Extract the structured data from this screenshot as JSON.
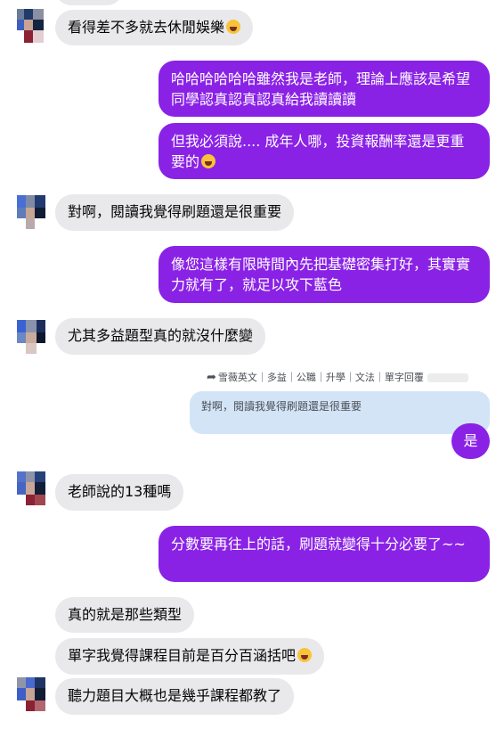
{
  "messages": {
    "m1": {
      "text": "看得差不多就去休閒娛樂"
    },
    "m2": {
      "text": "哈哈哈哈哈哈雖然我是老師，理論上應該是希望同學認真認真認真給我讀讀讀"
    },
    "m3": {
      "text": "但我必須說....  成年人哪，投資報酬率還是更重要的"
    },
    "m4": {
      "text": "對啊，閱讀我覺得刷題還是很重要"
    },
    "m5": {
      "text": "像您這樣有限時間內先把基礎密集打好，其實實力就有了，就足以攻下藍色"
    },
    "m6": {
      "text": "尤其多益題型真的就沒什麼變"
    },
    "reply": {
      "header": "雪薇英文｜多益｜公職｜升學｜文法｜單字回覆",
      "quoted": "對啊，閱讀我覺得刷題還是很重要",
      "text": "是"
    },
    "m7": {
      "text": "老師說的13種嗎"
    },
    "m8": {
      "text": "分數要再往上的話，刷題就變得十分必要了~~"
    },
    "m9": {
      "text": "真的就是那些類型"
    },
    "m10": {
      "text": "單字我覺得課程目前是百分百涵括吧"
    },
    "m11": {
      "text": "聽力題目大概也是幾乎課程都教了"
    }
  },
  "colors": {
    "outgoing": "#8a22e6",
    "incoming": "#e9e9eb",
    "quote": "#d3e4f7"
  }
}
